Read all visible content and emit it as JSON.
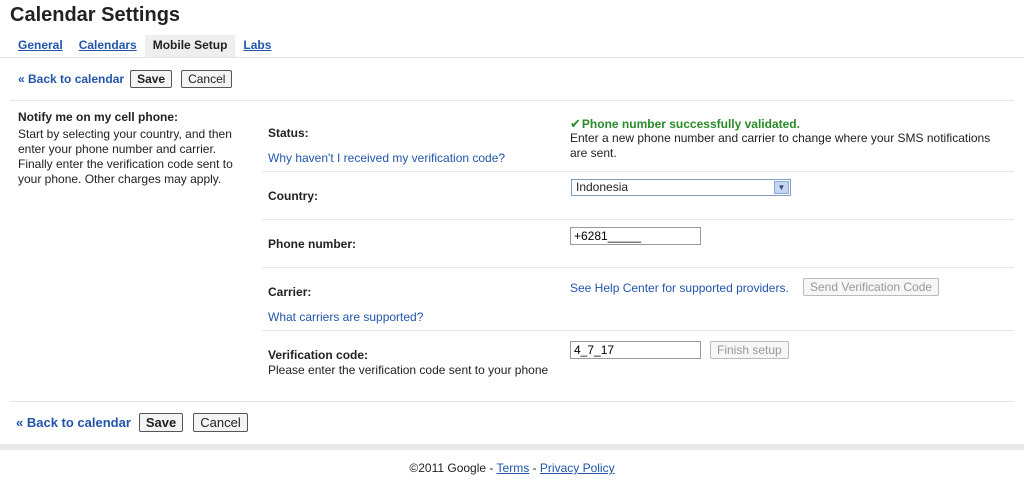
{
  "page": {
    "title": "Calendar Settings"
  },
  "tabs": [
    {
      "label": "General"
    },
    {
      "label": "Calendars"
    },
    {
      "label": "Mobile Setup"
    },
    {
      "label": "Labs"
    }
  ],
  "actions": {
    "back_label": "« Back to calendar",
    "save_label": "Save",
    "cancel_label": "Cancel"
  },
  "notify": {
    "title": "Notify me on my cell phone:",
    "description": "Start by selecting your country, and then enter your phone number and carrier. Finally enter the verification code sent to your phone. Other charges may apply."
  },
  "status": {
    "label": "Status:",
    "help_link": "Why haven't I received my verification code?",
    "message": "Phone number successfully validated.",
    "description": "Enter a new phone number and carrier to change where your SMS notifications are sent."
  },
  "country": {
    "label": "Country:",
    "selected": "Indonesia"
  },
  "phone": {
    "label": "Phone number:",
    "value": "+6281_____"
  },
  "carrier": {
    "label": "Carrier:",
    "help_link": "What carriers are supported?",
    "help_center_text": "See Help Center for supported providers.",
    "send_button": "Send Verification Code"
  },
  "verification": {
    "label": "Verification code:",
    "note": "Please enter the verification code sent to your phone",
    "value": "4_7_17",
    "finish_button": "Finish setup"
  },
  "footer": {
    "copyright": "©2011 Google",
    "separator": "-",
    "terms": "Terms",
    "privacy": "Privacy Policy"
  },
  "colors": {
    "link": "#2255aa",
    "success": "#2a8a2a"
  }
}
